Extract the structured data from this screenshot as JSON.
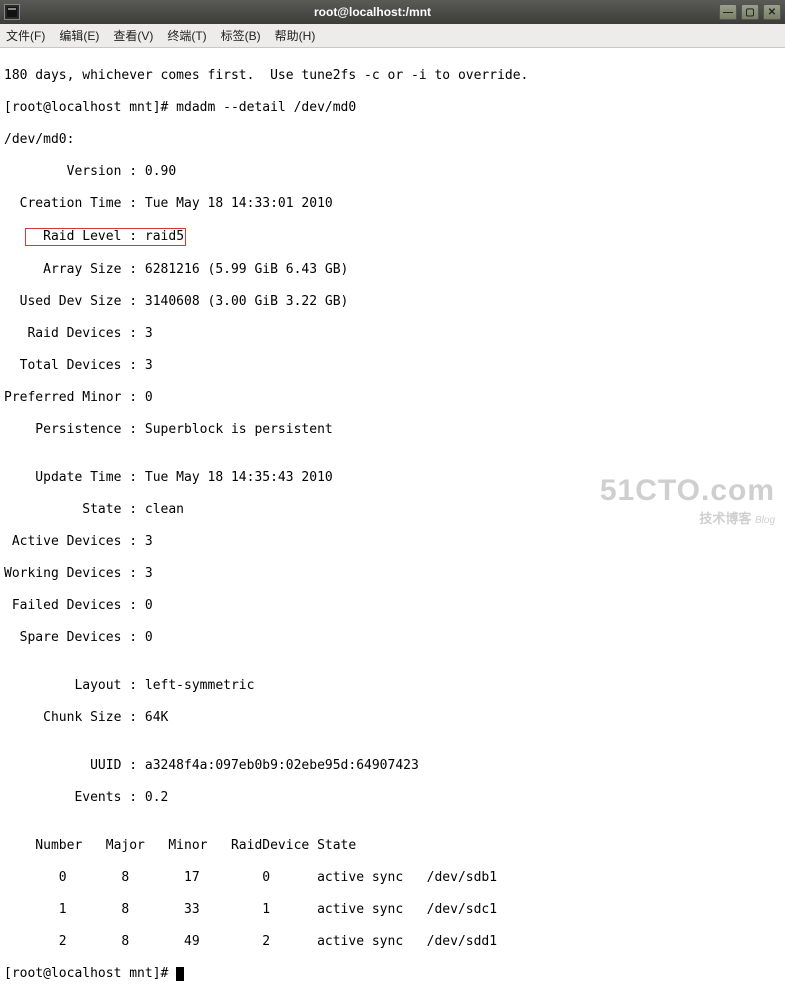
{
  "window": {
    "title": "root@localhost:/mnt"
  },
  "menu": {
    "file": "文件(F)",
    "edit": "编辑(E)",
    "view": "查看(V)",
    "terminal": "终端(T)",
    "tabs": "标签(B)",
    "help": "帮助(H)"
  },
  "t": {
    "l0": "180 days, whichever comes first.  Use tune2fs -c or -i to override.",
    "l1": "[root@localhost mnt]# mdadm --detail /dev/md0",
    "l2": "/dev/md0:",
    "l3": "        Version : 0.90",
    "l4": "  Creation Time : Tue May 18 14:33:01 2010",
    "l5_label": "     Raid Level : raid5",
    "l6": "     Array Size : 6281216 (5.99 GiB 6.43 GB)",
    "l7": "  Used Dev Size : 3140608 (3.00 GiB 3.22 GB)",
    "l8": "   Raid Devices : 3",
    "l9": "  Total Devices : 3",
    "l10": "Preferred Minor : 0",
    "l11": "    Persistence : Superblock is persistent",
    "l12": "",
    "l13": "    Update Time : Tue May 18 14:35:43 2010",
    "l14": "          State : clean",
    "l15": " Active Devices : 3",
    "l16": "Working Devices : 3",
    "l17": " Failed Devices : 0",
    "l18": "  Spare Devices : 0",
    "l19": "",
    "l20": "         Layout : left-symmetric",
    "l21": "     Chunk Size : 64K",
    "l22": "",
    "l23": "           UUID : a3248f4a:097eb0b9:02ebe95d:64907423",
    "l24": "         Events : 0.2",
    "l25": "",
    "hdr": "    Number   Major   Minor   RaidDevice State",
    "r0": "       0       8       17        0      active sync   /dev/sdb1",
    "r1": "       1       8       33        1      active sync   /dev/sdc1",
    "r2": "       2       8       49        2      active sync   /dev/sdd1",
    "prompt": "[root@localhost mnt]# "
  },
  "watermark": {
    "big": "51CTO.com",
    "sub": "技术博客",
    "blog": "Blog"
  }
}
